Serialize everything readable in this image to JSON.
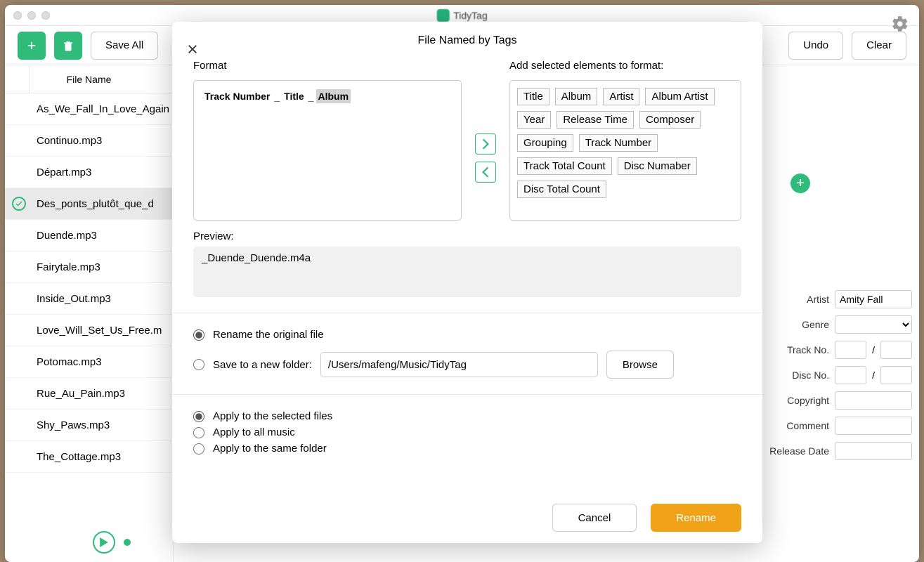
{
  "app": {
    "title": "TidyTag"
  },
  "toolbar": {
    "save_all": "Save All",
    "undo": "Undo",
    "clear": "Clear"
  },
  "filelist": {
    "header": "File Name",
    "items": [
      {
        "name": "As_We_Fall_In_Love_Again",
        "selected": false
      },
      {
        "name": "Continuo.mp3",
        "selected": false
      },
      {
        "name": "Départ.mp3",
        "selected": false
      },
      {
        "name": "Des_ponts_plutôt_que_d",
        "selected": true
      },
      {
        "name": "Duende.mp3",
        "selected": false
      },
      {
        "name": "Fairytale.mp3",
        "selected": false
      },
      {
        "name": "Inside_Out.mp3",
        "selected": false
      },
      {
        "name": "Love_Will_Set_Us_Free.m",
        "selected": false
      },
      {
        "name": "Potomac.mp3",
        "selected": false
      },
      {
        "name": "Rue_Au_Pain.mp3",
        "selected": false
      },
      {
        "name": "Shy_Paws.mp3",
        "selected": false
      },
      {
        "name": "The_Cottage.mp3",
        "selected": false
      }
    ]
  },
  "meta": {
    "artist_label": "Artist",
    "artist_value": "Amity Fall",
    "genre_label": "Genre",
    "track_label": "Track No.",
    "track_sep": "/",
    "disc_label": "Disc No.",
    "disc_sep": "/",
    "copyright_label": "Copyright",
    "comment_label": "Comment",
    "release_label": "Release Date"
  },
  "modal": {
    "title": "File Named by Tags",
    "format_label": "Format",
    "format_tokens": [
      {
        "text": "Track Number",
        "sep": "_"
      },
      {
        "text": "Title",
        "sep": "_"
      },
      {
        "text": "Album",
        "sep": "",
        "selected": true
      }
    ],
    "elements_label": "Add selected elements to format:",
    "elements": [
      "Title",
      "Album",
      "Artist",
      "Album Artist",
      "Year",
      "Release Time",
      "Composer",
      "Grouping",
      "Track Number",
      "Track Total Count",
      "Disc Numaber",
      "Disc Total Count"
    ],
    "preview_label": "Preview:",
    "preview_value": "_Duende_Duende.m4a",
    "opt_rename": "Rename the original file",
    "opt_save": "Save to a new folder:",
    "save_path": "/Users/mafeng/Music/TidyTag",
    "browse": "Browse",
    "apply_selected": "Apply to the selected files",
    "apply_all": "Apply to all music",
    "apply_folder": "Apply to the same folder",
    "cancel": "Cancel",
    "rename": "Rename"
  }
}
